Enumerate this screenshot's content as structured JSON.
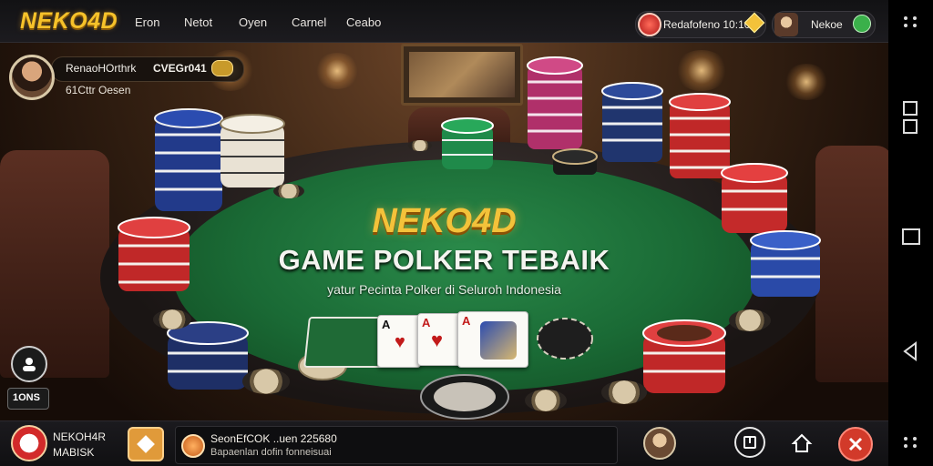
{
  "header": {
    "logo": "NEKO4D",
    "nav": [
      "Eron",
      "Netot",
      "Oyen",
      "Carnel",
      "Ceabo"
    ],
    "balance_text": "Redafofeno 10:10",
    "user_name": "Nekoe"
  },
  "player": {
    "name": "RenaoHOrthrk",
    "rank_text": "CVEGr041",
    "status_text": "61Cttr Oesen"
  },
  "hero": {
    "brand": "NEKO4D",
    "title": "GAME POLKER TEBAIK",
    "subtitle": "yatur Pecinta Polker di Seluroh Indonesia"
  },
  "cards": [
    "A",
    "A",
    "A"
  ],
  "side": {
    "counter_text": "1ONS"
  },
  "footer": {
    "brand_line1": "NEKOH4R",
    "brand_line2": "MABISK",
    "ticker_line1": "SeonEfCOK ..uen 225680",
    "ticker_line2": "Bapaenlan dofin fonneisuai"
  },
  "colors": {
    "accent": "#f3c23a",
    "felt": "#1a6a35",
    "danger": "#d23a2a"
  },
  "icons": [
    "coin-icon",
    "avatar-icon",
    "home-icon",
    "book-icon",
    "close-icon",
    "back-icon",
    "menu-dots-icon"
  ]
}
